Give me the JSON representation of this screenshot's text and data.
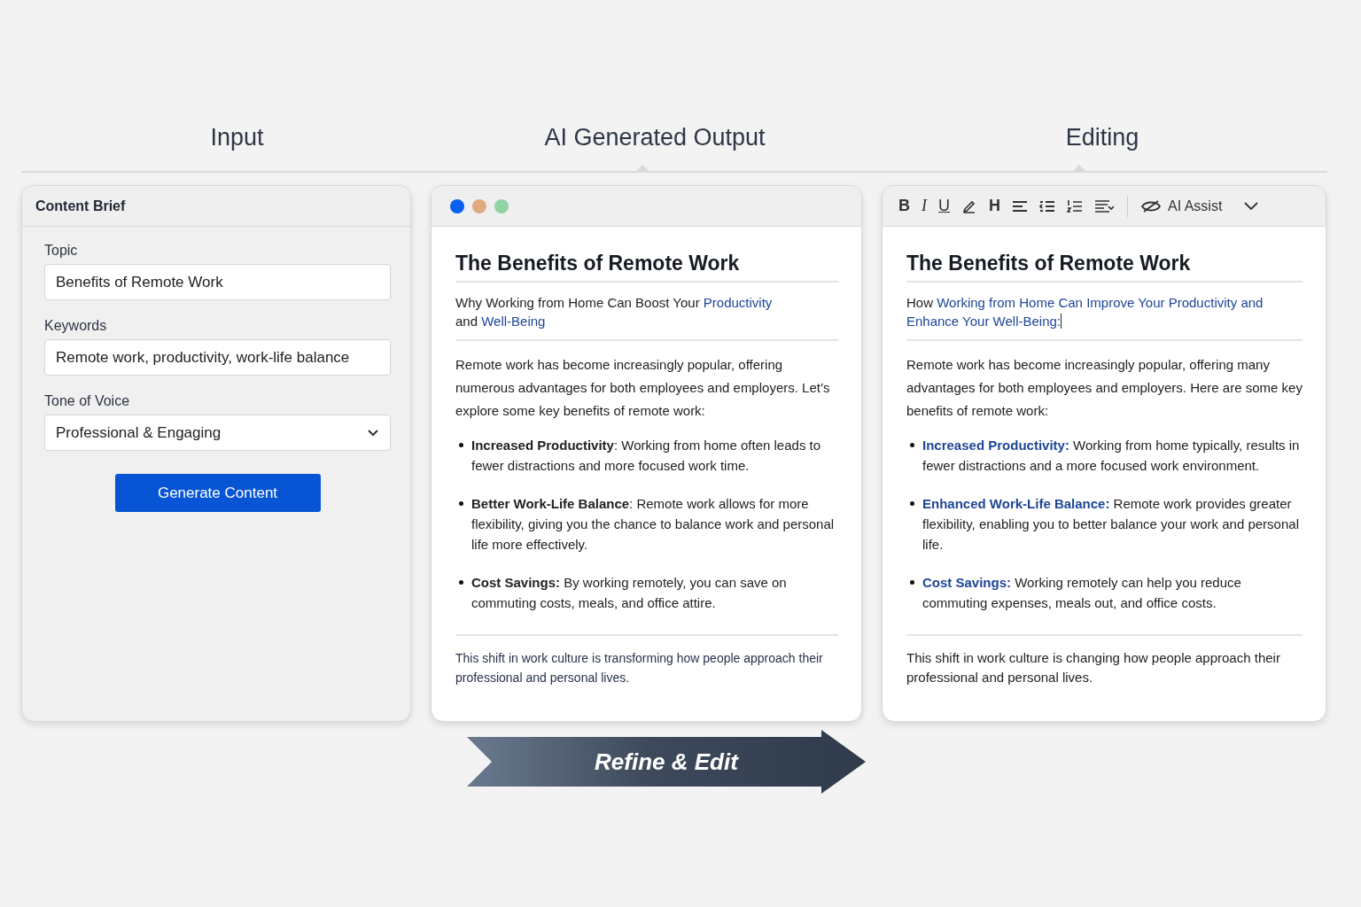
{
  "stages": [
    "Input",
    "AI Generated Output",
    "Editing"
  ],
  "input_panel": {
    "title": "Content Brief",
    "fields": [
      {
        "label": "Topic",
        "value": "Benefits of Remote Work",
        "kind": "text"
      },
      {
        "label": "Keywords",
        "value": "Remote work, productivity, work-life balance",
        "kind": "text"
      },
      {
        "label": "Tone of Voice",
        "value": "Professional & Engaging",
        "kind": "select"
      }
    ],
    "button": "Generate Content"
  },
  "output_panel": {
    "window_dots": [
      {
        "color": "#0a5ef0"
      },
      {
        "color": "#e0aa7e"
      },
      {
        "color": "#8fd3a4"
      }
    ],
    "title": "The Benefits of Remote Work",
    "subtitle": [
      {
        "text": "Why Working from Home Can Boost Your ",
        "highlighted": false
      },
      {
        "text": "Productivity",
        "highlighted": true
      },
      {
        "text": " and ",
        "highlighted": false
      },
      {
        "text": "Well-Being",
        "highlighted": true
      }
    ],
    "intro": "Remote work has become increasingly popular, offering numerous advantages for both employees and employers. Let’s explore some key benefits of remote work:",
    "bullets": [
      "**Increased Productivity**: Working from home often leads to fewer distractions and more focused work time.",
      "**Better Work-Life Balance**: Remote work allows for more flexibility, giving you the chance to balance work and personal life more effectively.",
      "**Cost Savings:** By working remotely, you can save on commuting costs, meals, and office attire."
    ],
    "closing": "This shift in work culture is transforming how people approach their professional and personal lives."
  },
  "editor_panel": {
    "format_buttons": [
      {
        "label": "B",
        "kind": "bold"
      },
      {
        "label": "I",
        "kind": "italic"
      },
      {
        "label": "U",
        "kind": "underline"
      }
    ],
    "heading_button": "H",
    "ai_assist": "AI Assist",
    "title": "The Benefits of Remote Work",
    "subtitle": [
      {
        "text": "How ",
        "highlighted": false
      },
      {
        "text": "Working from Home Can Improve Your Productivity and Enhance Your Well-Being:",
        "highlighted": true
      }
    ],
    "cursor": true,
    "intro": "Remote work has become increasingly popular, offering many advantages for both employees and employers. Here are some key benefits of remote work:",
    "bullets": [
      "**Increased Productivity:** Working from home typically, results in fewer distractions and a more focused work environment.",
      "**Enhanced Work-Life Balance:** Remote work provides greater flexibility, enabling you to better balance your work and personal life.",
      "**Cost Savings:** Working remotely can help you reduce commuting expenses, meals out, and office costs."
    ],
    "closing": "This shift in work culture is changing how people approach their professional and personal lives."
  },
  "arrow": {
    "label": "Refine & Edit"
  }
}
